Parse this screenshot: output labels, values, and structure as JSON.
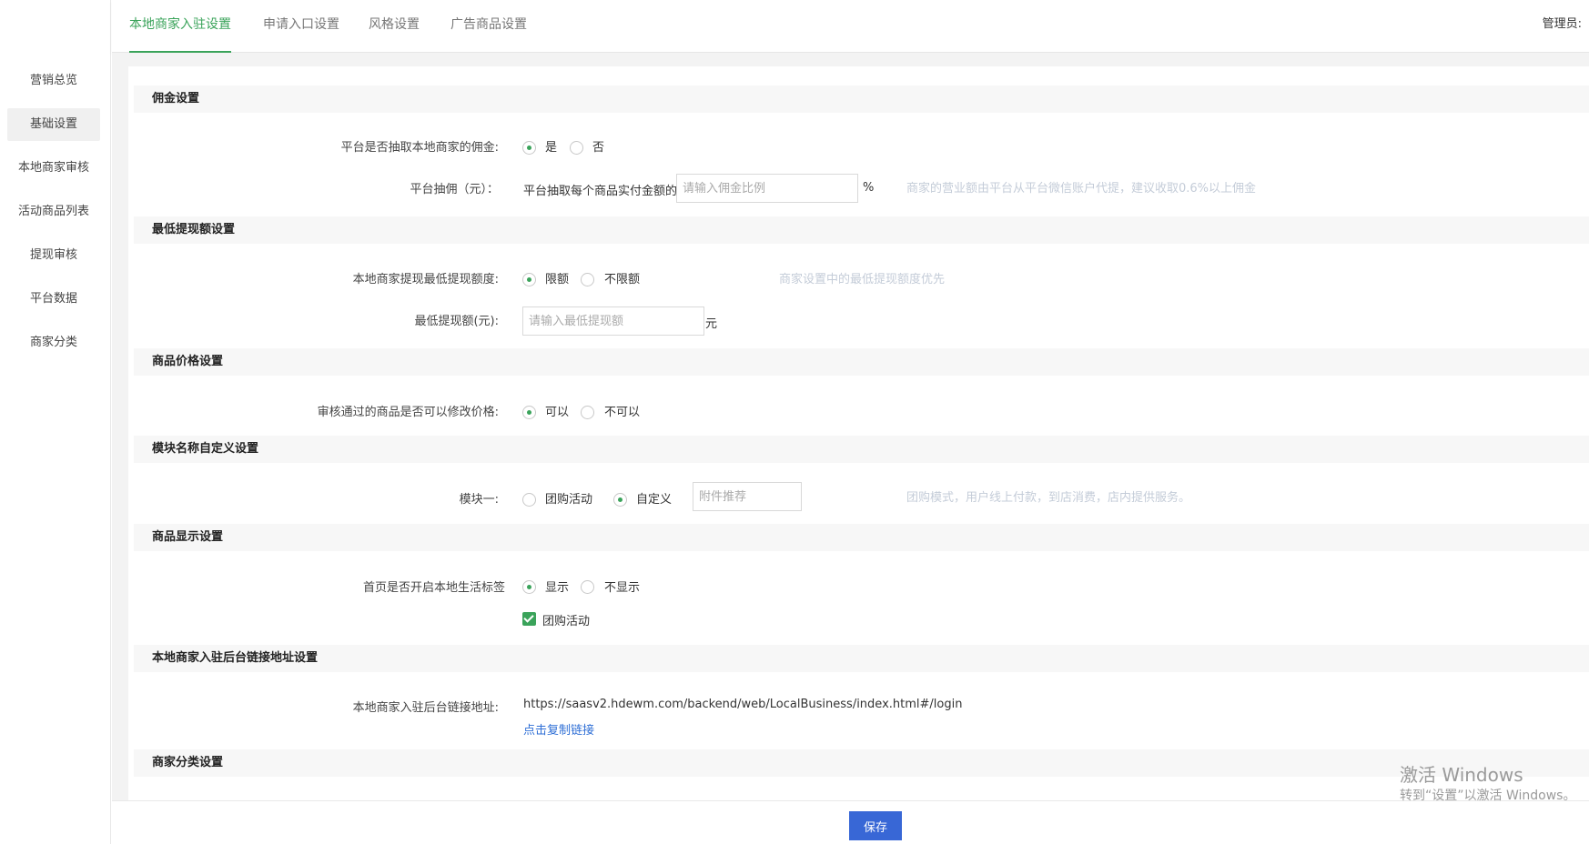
{
  "sidebar": {
    "items": [
      {
        "label": "营销总览",
        "active": false
      },
      {
        "label": "基础设置",
        "active": true
      },
      {
        "label": "本地商家审核",
        "active": false
      },
      {
        "label": "活动商品列表",
        "active": false
      },
      {
        "label": "提现审核",
        "active": false
      },
      {
        "label": "平台数据",
        "active": false
      },
      {
        "label": "商家分类",
        "active": false
      }
    ]
  },
  "header": {
    "tabs": [
      {
        "label": "本地商家入驻设置",
        "active": true
      },
      {
        "label": "申请入口设置",
        "active": false
      },
      {
        "label": "风格设置",
        "active": false
      },
      {
        "label": "广告商品设置",
        "active": false
      }
    ],
    "admin_label": "管理员:"
  },
  "commission": {
    "title": "佣金设置",
    "question_label": "平台是否抽取本地商家的佣金:",
    "option_yes": "是",
    "option_no": "否",
    "selected": "yes",
    "rate_label": "平台抽佣（元）：",
    "rate_prefix": "平台抽取每个商品实付金额的",
    "rate_placeholder": "请输入佣金比例",
    "rate_unit": "%",
    "rate_hint": "商家的营业额由平台从平台微信账户代提，建议收取0.6%以上佣金"
  },
  "withdraw": {
    "title": "最低提现额设置",
    "limit_label": "本地商家提现最低提现额度:",
    "option_limit": "限额",
    "option_unlimited": "不限额",
    "selected": "limit",
    "limit_hint": "商家设置中的最低提现额度优先",
    "min_label": "最低提现额(元):",
    "min_placeholder": "请输入最低提现额",
    "min_unit": "元"
  },
  "price": {
    "title": "商品价格设置",
    "edit_label": "审核通过的商品是否可以修改价格:",
    "option_yes": "可以",
    "option_no": "不可以",
    "selected": "yes"
  },
  "module_name": {
    "title": "模块名称自定义设置",
    "module1_label": "模块一:",
    "option_group": "团购活动",
    "option_custom": "自定义",
    "selected": "custom",
    "custom_placeholder": "附件推荐",
    "hint": "团购模式，用户线上付款，到店消费，店内提供服务。"
  },
  "display": {
    "title": "商品显示设置",
    "home_label": "首页是否开启本地生活标签",
    "option_show": "显示",
    "option_hide": "不显示",
    "selected": "show",
    "checkbox_label": "团购活动",
    "checkbox_checked": true
  },
  "backend_link": {
    "title": "本地商家入驻后台链接地址设置",
    "link_label": "本地商家入驻后台链接地址:",
    "url": "https://saasv2.hdewm.com/backend/web/LocalBusiness/index.html#/login",
    "copy_label": "点击复制链接"
  },
  "category": {
    "title": "商家分类设置"
  },
  "footer": {
    "save_label": "保存"
  },
  "watermark": {
    "line1": "激活 Windows",
    "line2": "转到“设置”以激活 Windows。"
  }
}
